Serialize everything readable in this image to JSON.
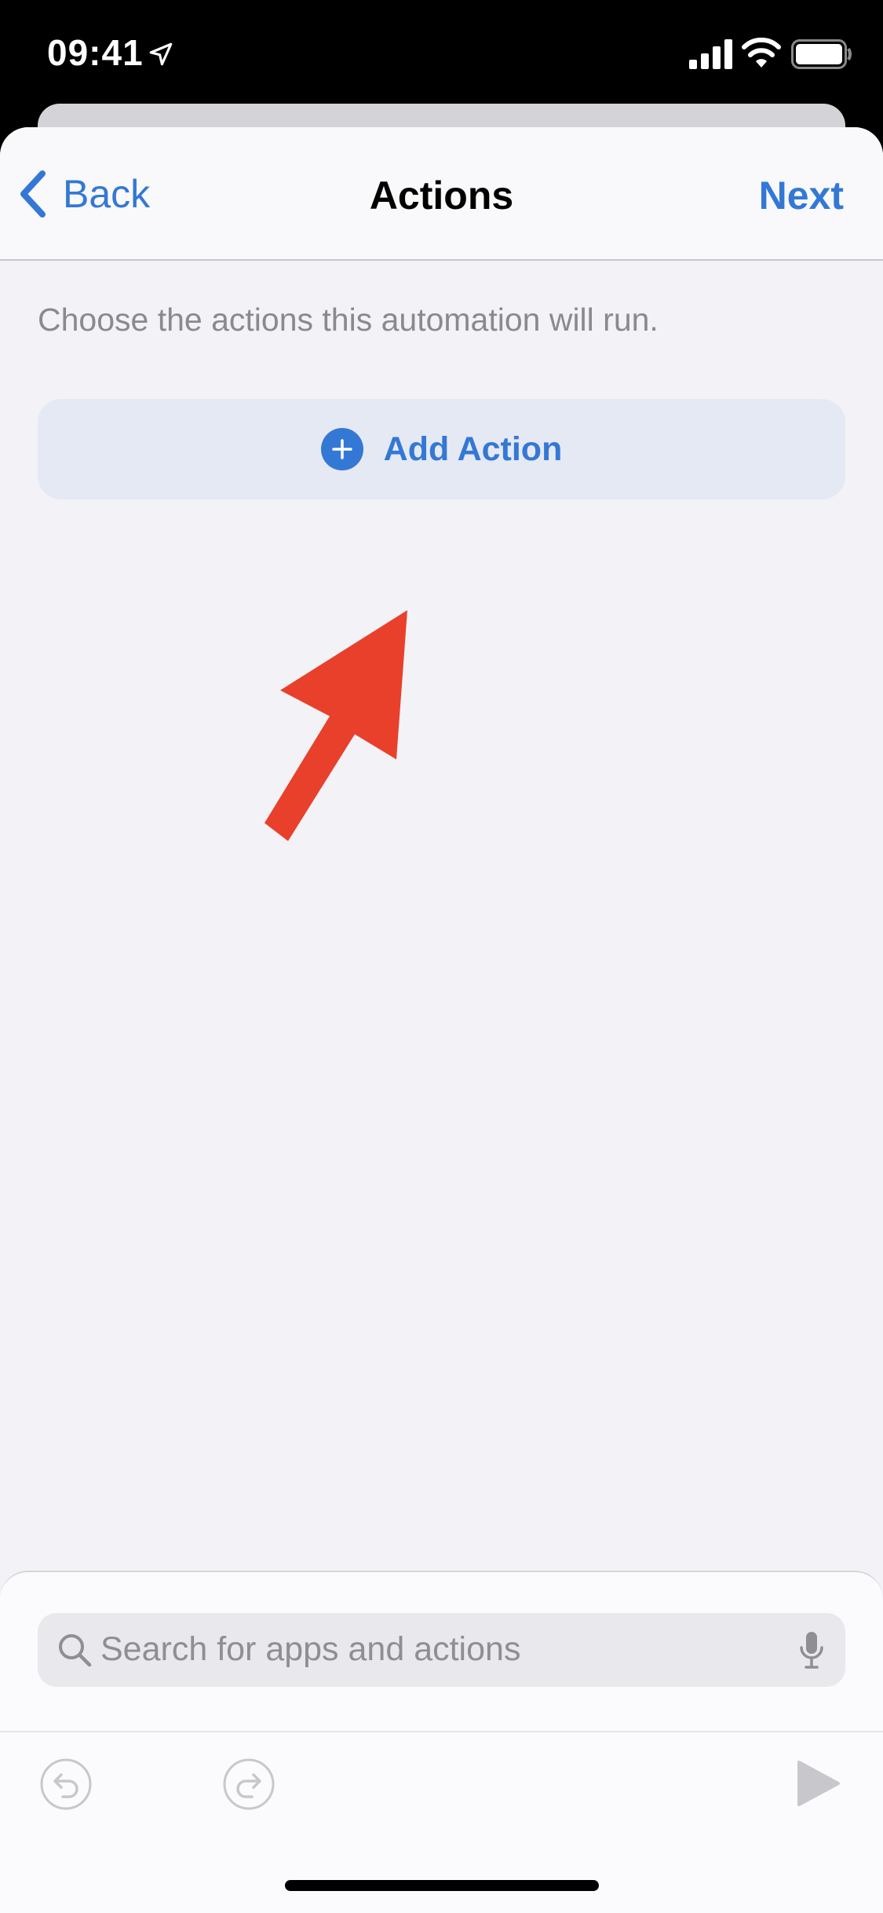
{
  "status_bar": {
    "time": "09:41"
  },
  "navbar": {
    "back_label": "Back",
    "title": "Actions",
    "next_label": "Next"
  },
  "main": {
    "description": "Choose the actions this automation will run.",
    "add_action_label": "Add Action"
  },
  "bottom": {
    "search_placeholder": "Search for apps and actions"
  },
  "colors": {
    "accent": "#3478d5",
    "arrow": "#e8402a",
    "background": "#f2f2f7"
  },
  "icons": [
    "location-icon",
    "signal-icon",
    "wifi-icon",
    "battery-icon",
    "chevron-left-icon",
    "plus-circle-icon",
    "search-icon",
    "microphone-icon",
    "undo-icon",
    "redo-icon",
    "play-icon"
  ]
}
